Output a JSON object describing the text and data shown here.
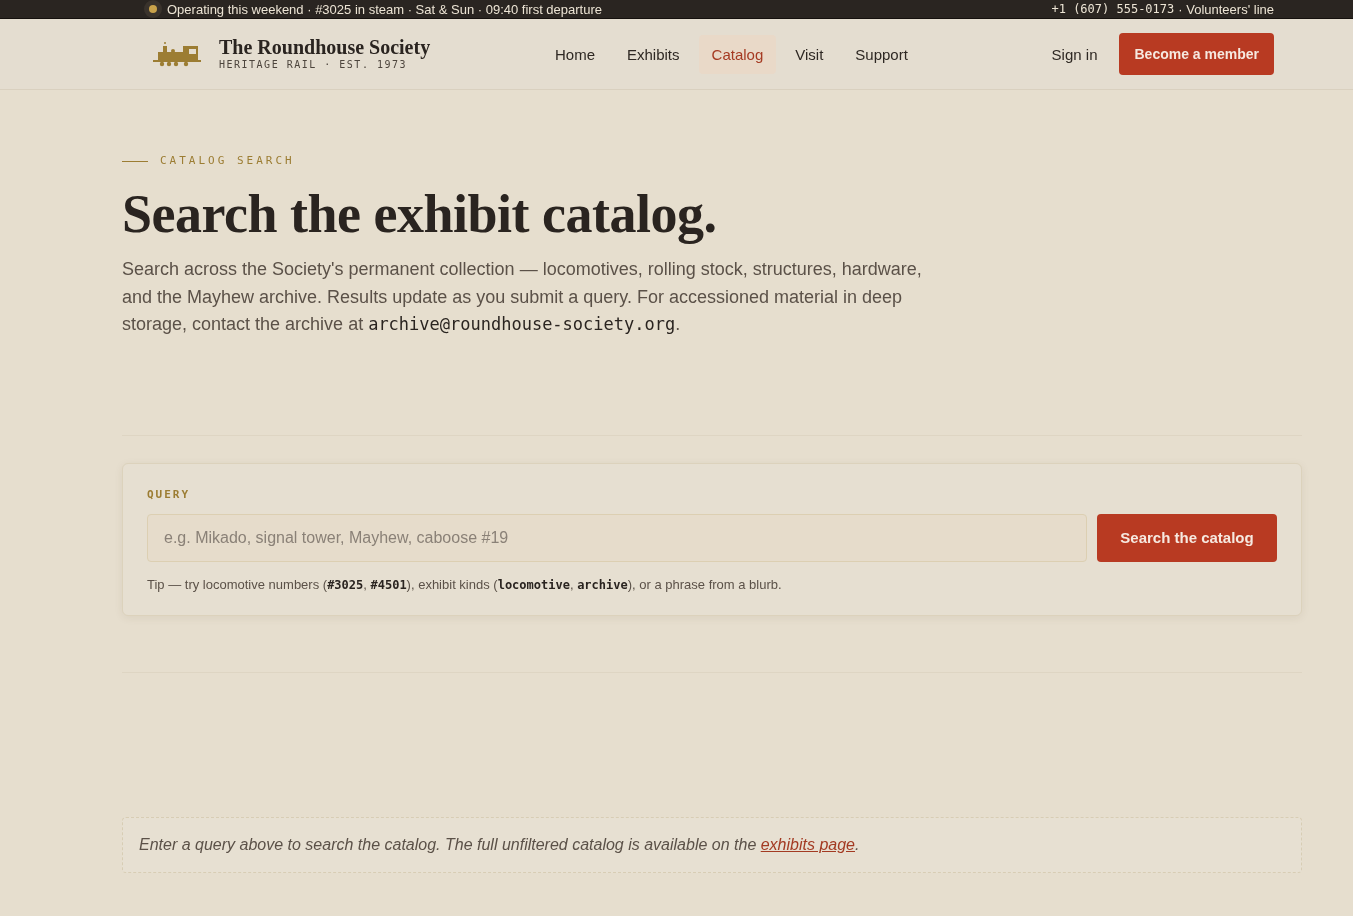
{
  "announcement_bar": {
    "status_text": "Operating this weekend · #3025 in steam · Sat & Sun · 09:40 first departure",
    "phone": "+1 (607) 555-0173",
    "phone_label": "· Volunteers' line"
  },
  "header": {
    "brand": {
      "name": "The Roundhouse Society",
      "tagline": "HERITAGE RAIL · EST. 1973"
    },
    "nav": [
      {
        "label": "Home",
        "selected": false
      },
      {
        "label": "Exhibits",
        "selected": false
      },
      {
        "label": "Catalog",
        "selected": true
      },
      {
        "label": "Visit",
        "selected": false
      },
      {
        "label": "Support",
        "selected": false
      }
    ],
    "sign_in": "Sign in",
    "cta": "Become a member"
  },
  "hero": {
    "eyebrow": "CATALOG SEARCH",
    "title": "Search the exhibit catalog.",
    "intro": "Search across the Society's permanent collection — locomotives, rolling stock, structures, hardware, and the Mayhew archive. Results update as you submit a query. For accessioned material in deep storage, contact the archive at **archive@roundhouse-society.org**."
  },
  "search": {
    "label": "QUERY",
    "placeholder": "e.g. Mikado, signal tower, Mayhew, caboose #19",
    "button": "Search the catalog",
    "tip": "Tip — try locomotive numbers (**#3025**, **#4501**), exhibit kinds (**locomotive**, **archive**), or a phrase from a blurb."
  },
  "empty_state": {
    "text": "Enter a query above to search the catalog. The full unfiltered catalog is available on the ",
    "link": "exhibits page",
    "text_after": "."
  }
}
